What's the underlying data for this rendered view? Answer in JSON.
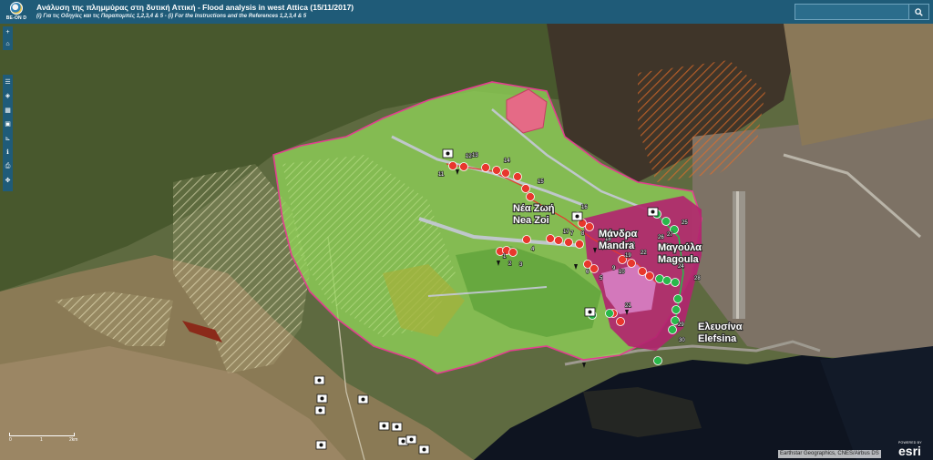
{
  "header": {
    "logo_text": "BE-ON D",
    "title": "Ανάλυση της πλημμύρας στη δυτική Αττική - Flood analysis in west Attica (15/11/2017)",
    "subtitle": "(i) Για τις Οδηγίες και τις Παραπομπές 1,2,3,4 & 5 - (i) For the Instructions and the References 1,2,3,4 & 5",
    "search_placeholder": "",
    "search_icon": "search-icon"
  },
  "zoom_controls": [
    {
      "name": "zoom-in",
      "glyph": "+"
    },
    {
      "name": "home",
      "glyph": "⌂"
    }
  ],
  "tools": [
    {
      "name": "list-icon",
      "glyph": "☰"
    },
    {
      "name": "layers-icon",
      "glyph": "◈"
    },
    {
      "name": "grid-icon",
      "glyph": "▦"
    },
    {
      "name": "basemap-icon",
      "glyph": "▣"
    },
    {
      "name": "measure-icon",
      "glyph": "⊾"
    },
    {
      "name": "info-icon",
      "glyph": "ℹ"
    },
    {
      "name": "print-icon",
      "glyph": "⎙"
    },
    {
      "name": "locate-icon",
      "glyph": "✥"
    }
  ],
  "places": [
    {
      "el": "Νέα Ζωή",
      "en": "Nea Zoi"
    },
    {
      "el": "Μάνδρα",
      "en": "Mandra"
    },
    {
      "el": "Μαγούλα",
      "en": "Magoula"
    },
    {
      "el": "Ελευσίνα",
      "en": "Elefsina"
    }
  ],
  "marker_numbers": [
    "11",
    "12",
    "13",
    "14",
    "15",
    "16",
    "17",
    "18",
    "19",
    "20",
    "21",
    "22",
    "23",
    "24",
    "25",
    "26",
    "27",
    "28",
    "29",
    "30",
    "1",
    "2",
    "3",
    "4",
    "5",
    "6",
    "7",
    "8",
    "9",
    "10"
  ],
  "scale": {
    "labels": [
      "0",
      "1",
      "2km"
    ]
  },
  "attribution": "Earthstar Geographics, CNES/Airbus DS",
  "esri": {
    "powered": "POWERED BY",
    "logo": "esri"
  },
  "colors": {
    "header": "#1f5b78",
    "watershed_green": "#8fd257",
    "watershed_border": "#e23e8f",
    "flood_magenta": "#b3236f",
    "marker_red": "#e8372d",
    "marker_green": "#29b84b",
    "sea": "#0e1420"
  }
}
